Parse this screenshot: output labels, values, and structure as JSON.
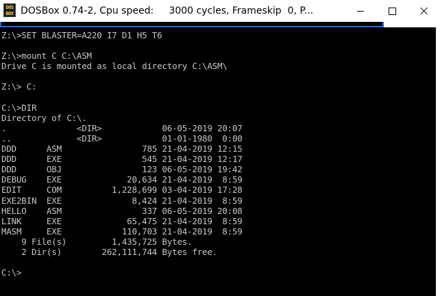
{
  "window": {
    "title": "DOSBox 0.74-2, Cpu speed:     3000 cycles, Frameskip  0, P...",
    "icon_label_top": "DOS",
    "icon_label_bottom": "BOX"
  },
  "controls": {
    "minimize": "minimize-icon",
    "maximize": "maximize-icon",
    "close": "close-icon"
  },
  "colors": {
    "console_bg": "#000000",
    "console_text": "#c8c8c8",
    "accent": "#1f6bd6"
  },
  "console": {
    "lines": [
      "Z:\\>SET BLASTER=A220 I7 D1 H5 T6",
      "",
      "Z:\\>mount C C:\\ASM",
      "Drive C is mounted as local directory C:\\ASM\\",
      "",
      "Z:\\> C:",
      "",
      "C:\\>DIR",
      "Directory of C:\\.",
      ".              <DIR>            06-05-2019 20:07",
      "..             <DIR>            01-01-1980  0:00",
      "DDD      ASM                785 21-04-2019 12:15",
      "DDD      EXE                545 21-04-2019 12:17",
      "DDD      OBJ                123 06-05-2019 19:42",
      "DEBUG    EXE             20,634 21-04-2019  8:59",
      "EDIT     COM          1,228,699 03-04-2019 17:28",
      "EXE2BIN  EXE              8,424 21-04-2019  8:59",
      "HELLO    ASM                337 06-05-2019 20:08",
      "LINK     EXE             65,475 21-04-2019  8:59",
      "MASM     EXE            110,703 21-04-2019  8:59",
      "    9 File(s)         1,435,725 Bytes.",
      "    2 Dir(s)        262,111,744 Bytes free.",
      "",
      "C:\\>"
    ]
  }
}
